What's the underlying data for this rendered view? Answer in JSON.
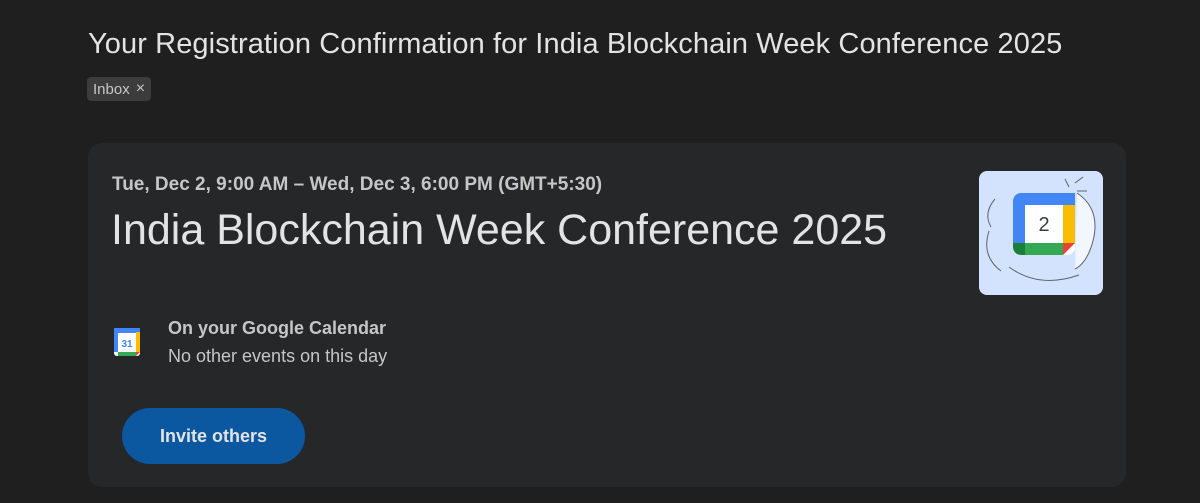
{
  "email": {
    "subject": "Your Registration Confirmation for India Blockchain Week Conference 2025",
    "label": {
      "text": "Inbox",
      "remove_glyph": "×"
    }
  },
  "event": {
    "time_range": "Tue, Dec 2, 9:00 AM – Wed, Dec 3, 6:00 PM (GMT+5:30)",
    "title": "India Blockchain Week Conference 2025",
    "hero_icon": "google-calendar-illustration-icon",
    "hero_day": "2",
    "calendar": {
      "icon": "google-calendar-icon",
      "icon_day": "31",
      "heading": "On your Google Calendar",
      "status": "No other events on this day"
    },
    "invite_button_label": "Invite others"
  },
  "colors": {
    "background": "#1f1f1f",
    "card": "#262729",
    "button": "#0b57a0",
    "text_primary": "#e3e3e3",
    "text_secondary": "#c4c7c5",
    "hero_bg": "#d3e3fd",
    "gcal_blue": "#4285f4",
    "gcal_red": "#ea4335",
    "gcal_yellow": "#fbbc04",
    "gcal_green": "#34a853"
  }
}
